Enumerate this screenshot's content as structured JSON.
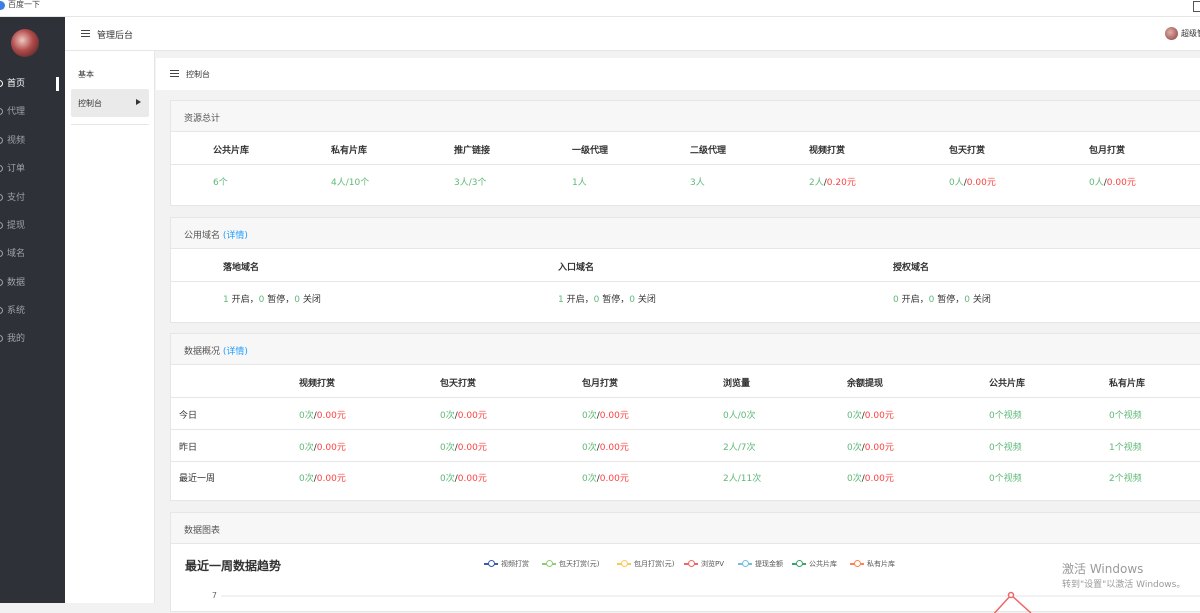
{
  "browser": {
    "tab_title": "百度一下"
  },
  "sidebar": {
    "items": [
      {
        "label": "首页",
        "active": true
      },
      {
        "label": "代理"
      },
      {
        "label": "视频"
      },
      {
        "label": "订单"
      },
      {
        "label": "支付"
      },
      {
        "label": "提现"
      },
      {
        "label": "域名"
      },
      {
        "label": "数据"
      },
      {
        "label": "系统"
      },
      {
        "label": "我的"
      }
    ]
  },
  "topbar": {
    "title": "管理后台",
    "user": "超级管"
  },
  "subnav": {
    "group": "基本",
    "item": "控制台"
  },
  "breadcrumb": "控制台",
  "resources": {
    "title": "资源总计",
    "columns": [
      {
        "label": "公共片库",
        "a": "6个",
        "sep": "",
        "b": ""
      },
      {
        "label": "私有片库",
        "a": "4人/10个",
        "sep": "",
        "b": ""
      },
      {
        "label": "推广链接",
        "a": "3人/3个",
        "sep": "",
        "b": ""
      },
      {
        "label": "一级代理",
        "a": "1人",
        "sep": "",
        "b": ""
      },
      {
        "label": "二级代理",
        "a": "3人",
        "sep": "",
        "b": ""
      },
      {
        "label": "视频打赏",
        "a": "2人",
        "sep": "/",
        "b": "0.20元"
      },
      {
        "label": "包天打赏",
        "a": "0人",
        "sep": "/",
        "b": "0.00元"
      },
      {
        "label": "包月打赏",
        "a": "0人",
        "sep": "/",
        "b": "0.00元"
      }
    ]
  },
  "domains": {
    "title": "公用域名",
    "detail": "(详情)",
    "columns": [
      {
        "label": "落地域名",
        "on": "1",
        "on_t": " 开启，",
        "pause": "0",
        "pause_t": " 暂停，",
        "off": "0",
        "off_t": " 关闭"
      },
      {
        "label": "入口域名",
        "on": "1",
        "on_t": " 开启，",
        "pause": "0",
        "pause_t": " 暂停，",
        "off": "0",
        "off_t": " 关闭"
      },
      {
        "label": "授权域名",
        "on": "0",
        "on_t": " 开启，",
        "pause": "0",
        "pause_t": " 暂停，",
        "off": "0",
        "off_t": " 关闭"
      }
    ]
  },
  "overview": {
    "title": "数据概况",
    "detail": "(详情)",
    "headers": [
      "视频打赏",
      "包天打赏",
      "包月打赏",
      "浏览量",
      "余额提现",
      "公共片库",
      "私有片库"
    ],
    "rows": [
      {
        "label": "今日",
        "video": [
          "0次",
          "0.00元"
        ],
        "day": [
          "0次",
          "0.00元"
        ],
        "month": [
          "0次",
          "0.00元"
        ],
        "views": "0人/0次",
        "withdraw": [
          "0次",
          "0.00元"
        ],
        "pub": "0个视频",
        "priv": "0个视频"
      },
      {
        "label": "昨日",
        "video": [
          "0次",
          "0.00元"
        ],
        "day": [
          "0次",
          "0.00元"
        ],
        "month": [
          "0次",
          "0.00元"
        ],
        "views": "2人/7次",
        "withdraw": [
          "0次",
          "0.00元"
        ],
        "pub": "0个视频",
        "priv": "1个视频"
      },
      {
        "label": "最近一周",
        "video": [
          "0次",
          "0.00元"
        ],
        "day": [
          "0次",
          "0.00元"
        ],
        "month": [
          "0次",
          "0.00元"
        ],
        "views": "2人/11次",
        "withdraw": [
          "0次",
          "0.00元"
        ],
        "pub": "0个视频",
        "priv": "2个视频"
      }
    ]
  },
  "charts": {
    "title": "数据图表",
    "chart_title": "最近一周数据趋势",
    "legend": [
      {
        "name": "视频打赏",
        "color": "#3c5ba8"
      },
      {
        "name": "包天打赏(元)",
        "color": "#91cc75"
      },
      {
        "name": "包月打赏(元)",
        "color": "#fac858"
      },
      {
        "name": "浏览PV",
        "color": "#ee6666"
      },
      {
        "name": "提现金额",
        "color": "#73c0de"
      },
      {
        "name": "公共片库",
        "color": "#3ba272"
      },
      {
        "name": "私有片库",
        "color": "#fc8452"
      }
    ],
    "y_tick_visible": "7"
  },
  "chart_data": {
    "type": "line",
    "title": "最近一周数据趋势",
    "series": [
      {
        "name": "视频打赏",
        "values": []
      },
      {
        "name": "包天打赏(元)",
        "values": []
      },
      {
        "name": "包月打赏(元)",
        "values": []
      },
      {
        "name": "浏览PV",
        "values": []
      },
      {
        "name": "提现金额",
        "values": []
      },
      {
        "name": "公共片库",
        "values": []
      },
      {
        "name": "私有片库",
        "values": []
      }
    ]
  },
  "watermark": {
    "line1": "激活 Windows",
    "line2": "转到\"设置\"以激活 Windows。"
  }
}
